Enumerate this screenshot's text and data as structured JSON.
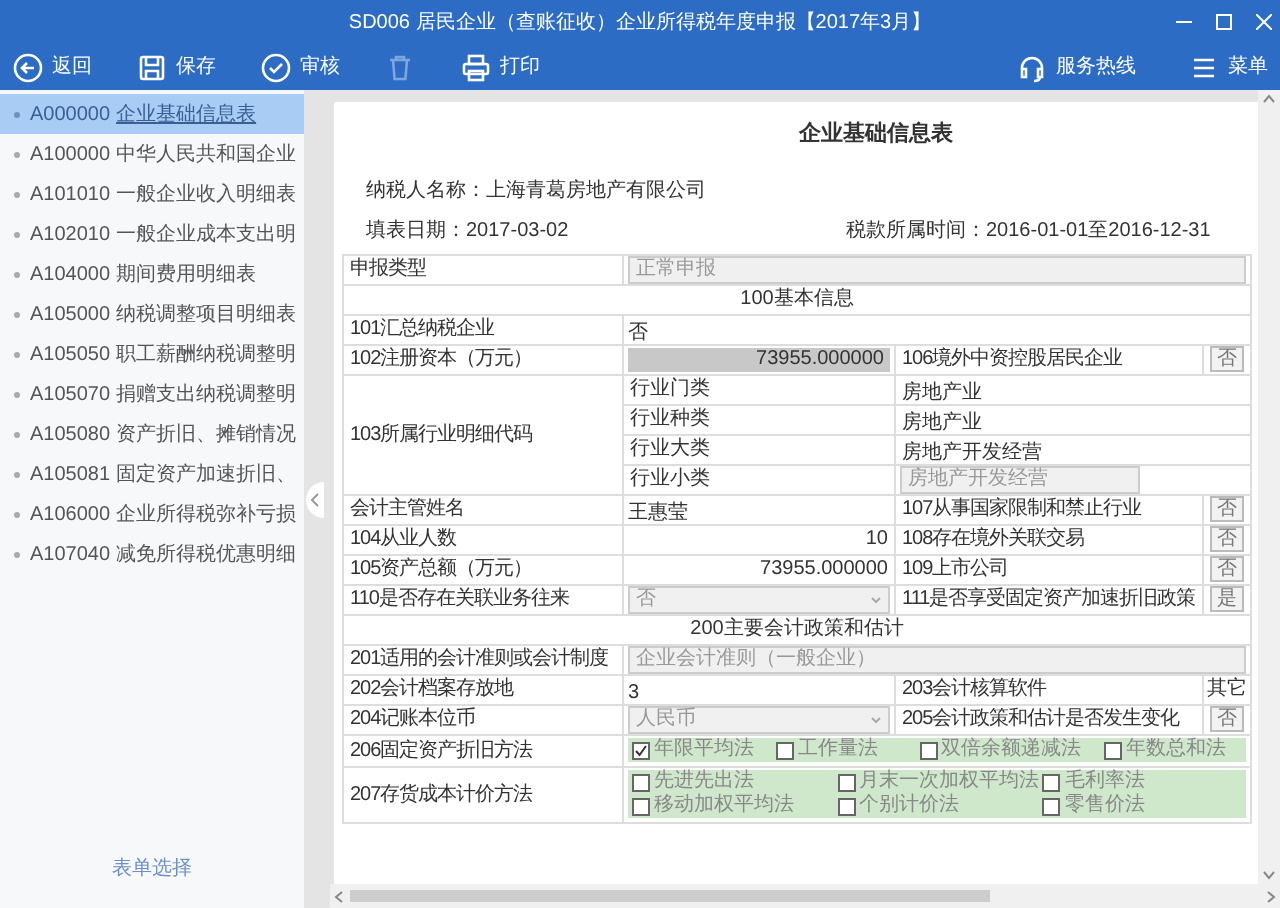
{
  "window": {
    "title": "SD006 居民企业（查账征收）企业所得税年度申报【2017年3月】"
  },
  "toolbar": {
    "left": [
      {
        "kind": "back",
        "label": "返回",
        "disabled": false
      },
      {
        "kind": "save",
        "label": "保存",
        "disabled": false
      },
      {
        "kind": "check",
        "label": "审核",
        "disabled": false
      },
      {
        "kind": "trash",
        "disabled": true
      },
      {
        "kind": "print",
        "label": "打印",
        "disabled": false
      }
    ],
    "right": [
      {
        "kind": "headset",
        "label": "服务热线"
      },
      {
        "kind": "menu",
        "label": "菜单"
      }
    ]
  },
  "sidebar": {
    "items": [
      {
        "code": "A000000",
        "name": "企业基础信息表",
        "selected": true
      },
      {
        "code": "A100000",
        "name": "中华人民共和国企业",
        "selected": false
      },
      {
        "code": "A101010",
        "name": "一般企业收入明细表",
        "selected": false
      },
      {
        "code": "A102010",
        "name": "一般企业成本支出明",
        "selected": false
      },
      {
        "code": "A104000",
        "name": "期间费用明细表",
        "selected": false
      },
      {
        "code": "A105000",
        "name": "纳税调整项目明细表",
        "selected": false
      },
      {
        "code": "A105050",
        "name": "职工薪酬纳税调整明",
        "selected": false
      },
      {
        "code": "A105070",
        "name": "捐赠支出纳税调整明",
        "selected": false
      },
      {
        "code": "A105080",
        "name": "资产折旧、摊销情况",
        "selected": false
      },
      {
        "code": "A105081",
        "name": "固定资产加速折旧、",
        "selected": false
      },
      {
        "code": "A106000",
        "name": "企业所得税弥补亏损",
        "selected": false
      },
      {
        "code": "A107040",
        "name": "减免所得税优惠明细",
        "selected": false
      }
    ],
    "footer_link": "表单选择"
  },
  "form": {
    "title": "企业基础信息表",
    "taxpayer": "纳税人名称：上海青葛房地产有限公司",
    "fill_date": "填表日期：2017-03-02",
    "tax_period": "税款所属时间：2016-01-01至2016-12-31",
    "rows": [
      {
        "kind": "full",
        "label": "申报类型",
        "value": {
          "kind": "readonly",
          "text": "正常申报"
        }
      },
      {
        "kind": "section",
        "title": "100基本信息"
      },
      {
        "kind": "full",
        "label": "101汇总纳税企业",
        "value": {
          "kind": "plain",
          "text": "否"
        }
      },
      {
        "kind": "pair",
        "label": "102注册资本（万元）",
        "value": {
          "kind": "bar",
          "text": "73955.000000"
        },
        "label2": "106境外中资控股居民企业",
        "value2": {
          "kind": "flag",
          "text": "否"
        }
      },
      {
        "kind": "industry",
        "label": "103所属行业明细代码",
        "items": [
          {
            "name": "行业门类",
            "value": "房地产业",
            "readonly": false
          },
          {
            "name": "行业种类",
            "value": "房地产业",
            "readonly": false
          },
          {
            "name": "行业大类",
            "value": "房地产开发经营",
            "readonly": false
          },
          {
            "name": "行业小类",
            "value": "房地产开发经营",
            "readonly": true
          }
        ]
      },
      {
        "kind": "pair",
        "label": "会计主管姓名",
        "value": {
          "kind": "plain",
          "text": "王惠莹"
        },
        "label2": "107从事国家限制和禁止行业",
        "value2": {
          "kind": "flag",
          "text": "否"
        }
      },
      {
        "kind": "pair",
        "label": "104从业人数",
        "value": {
          "kind": "number",
          "text": "10"
        },
        "label2": "108存在境外关联交易",
        "value2": {
          "kind": "flag",
          "text": "否"
        }
      },
      {
        "kind": "pair",
        "label": "105资产总额（万元）",
        "value": {
          "kind": "number",
          "text": "73955.000000"
        },
        "label2": "109上市公司",
        "value2": {
          "kind": "flag",
          "text": "否"
        }
      },
      {
        "kind": "pair",
        "label": "110是否存在关联业务往来",
        "value": {
          "kind": "dropdown",
          "text": "否"
        },
        "label2": "111是否享受固定资产加速折旧政策",
        "value2": {
          "kind": "flag",
          "text": "是"
        }
      },
      {
        "kind": "section",
        "title": "200主要会计政策和估计"
      },
      {
        "kind": "full",
        "label": "201适用的会计准则或会计制度",
        "value": {
          "kind": "readonly",
          "text": "企业会计准则（一般企业）"
        }
      },
      {
        "kind": "pair",
        "label": "202会计档案存放地",
        "value": {
          "kind": "plain",
          "text": "3"
        },
        "label2": "203会计核算软件",
        "value2": {
          "kind": "plain",
          "text": "其它"
        }
      },
      {
        "kind": "pair",
        "label": "204记账本位币",
        "value": {
          "kind": "dropdown",
          "text": "人民币"
        },
        "label2": "205会计政策和估计是否发生变化",
        "value2": {
          "kind": "flag",
          "text": "否"
        }
      },
      {
        "kind": "checks",
        "label": "206固定资产折旧方法",
        "options": [
          {
            "label": "年限平均法",
            "checked": true
          },
          {
            "label": "工作量法",
            "checked": false
          },
          {
            "label": "双倍余额递减法",
            "checked": false
          },
          {
            "label": "年数总和法",
            "checked": false
          }
        ]
      },
      {
        "kind": "checks",
        "label": "207存货成本计价方法",
        "options": [
          {
            "label": "先进先出法",
            "checked": false
          },
          {
            "label": "月末一次加权平均法",
            "checked": false
          },
          {
            "label": "毛利率法",
            "checked": false
          },
          {
            "label": "移动加权平均法",
            "checked": false
          },
          {
            "label": "个别计价法",
            "checked": false
          },
          {
            "label": "零售价法",
            "checked": false
          }
        ]
      }
    ]
  }
}
